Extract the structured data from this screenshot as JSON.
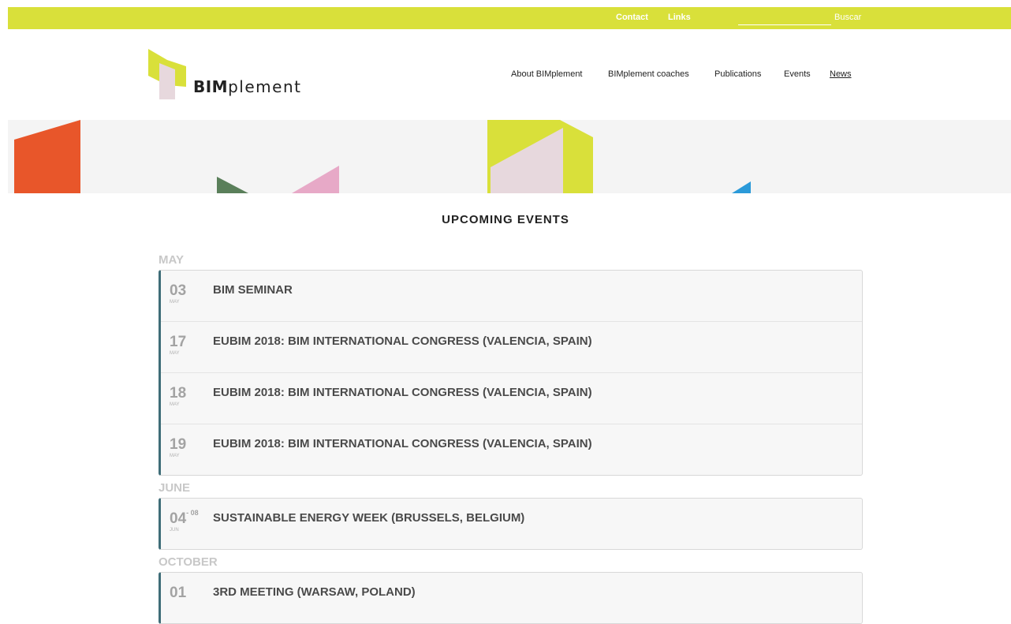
{
  "topbar": {
    "contact": "Contact",
    "links": "Links",
    "search_placeholder": "",
    "search_button": "Buscar",
    "color": "#d9e03a"
  },
  "logo": {
    "text_bold": "BIM",
    "text_light": "plement"
  },
  "nav": {
    "items": [
      {
        "label": "About BIMplement"
      },
      {
        "label": "BIMplement coaches"
      },
      {
        "label": "Publications"
      },
      {
        "label": "Events"
      },
      {
        "label": "News",
        "active": true
      }
    ]
  },
  "page": {
    "title": "UPCOMING EVENTS"
  },
  "months": [
    {
      "name": "MAY",
      "events": [
        {
          "day": "03",
          "day_end": "",
          "mon": "MAY",
          "title": "BIM SEMINAR"
        },
        {
          "day": "17",
          "day_end": "",
          "mon": "MAY",
          "title": "EUBIM 2018: BIM INTERNATIONAL CONGRESS (VALENCIA, SPAIN)"
        },
        {
          "day": "18",
          "day_end": "",
          "mon": "MAY",
          "title": "EUBIM 2018: BIM INTERNATIONAL CONGRESS (VALENCIA, SPAIN)"
        },
        {
          "day": "19",
          "day_end": "",
          "mon": "MAY",
          "title": "EUBIM 2018: BIM INTERNATIONAL CONGRESS (VALENCIA, SPAIN)"
        }
      ]
    },
    {
      "name": "JUNE",
      "events": [
        {
          "day": "04",
          "day_end": "- 08",
          "mon": "JUN",
          "title": "SUSTAINABLE ENERGY WEEK (BRUSSELS, BELGIUM)"
        }
      ]
    },
    {
      "name": "OCTOBER",
      "events": [
        {
          "day": "01",
          "day_end": "",
          "mon": "",
          "title": "3RD MEETING (WARSAW, POLAND)"
        }
      ]
    }
  ],
  "colors": {
    "accent_lime": "#d9e03a",
    "accent_teal": "#3f6d78",
    "shape_orange": "#e8562a",
    "shape_green": "#5a7f5a",
    "shape_pink": "#e7a9c7",
    "shape_lightpink": "#e7d8dd",
    "shape_blue": "#2b9ad9"
  }
}
